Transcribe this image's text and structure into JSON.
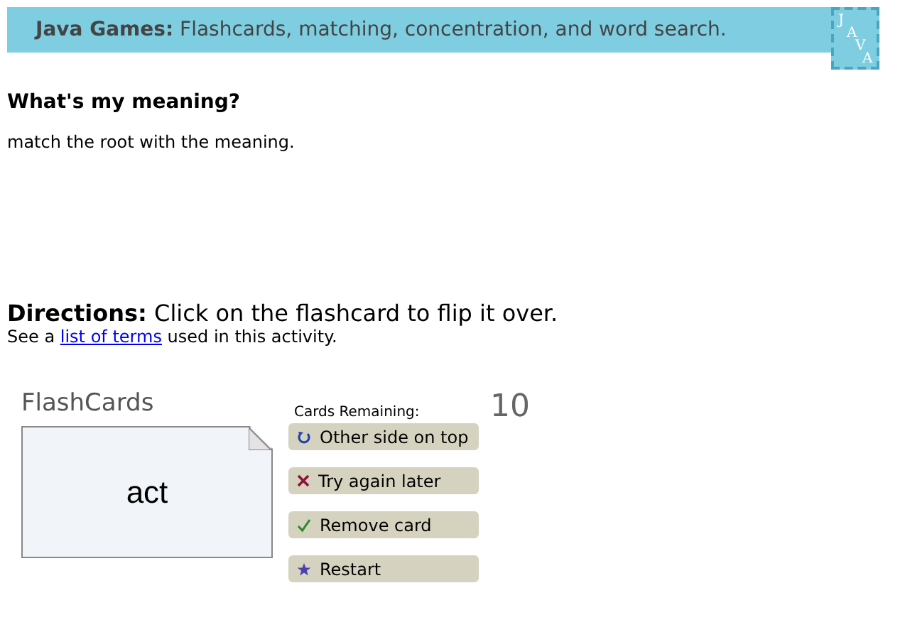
{
  "banner": {
    "title_bold": "Java Games:",
    "title": "Flashcards, matching, concentration, and word search.",
    "logo_letters": [
      "J",
      "A",
      "V",
      "A"
    ]
  },
  "heading": "What's my meaning?",
  "description": "match the root with the meaning.",
  "directions": {
    "label": "Directions:",
    "text": "Click on the flashcard to flip it over.",
    "see_before": "See a",
    "link": "list of terms",
    "see_after": "used in this activity."
  },
  "flashcards": {
    "title": "FlashCards",
    "card_text": "act",
    "remaining_label": "Cards Remaining:",
    "remaining": "10",
    "buttons": [
      {
        "kind": "flip",
        "label": "Other side on top"
      },
      {
        "kind": "later",
        "label": "Try again later"
      },
      {
        "kind": "remove",
        "label": "Remove card"
      },
      {
        "kind": "restart",
        "label": "Restart"
      }
    ]
  }
}
